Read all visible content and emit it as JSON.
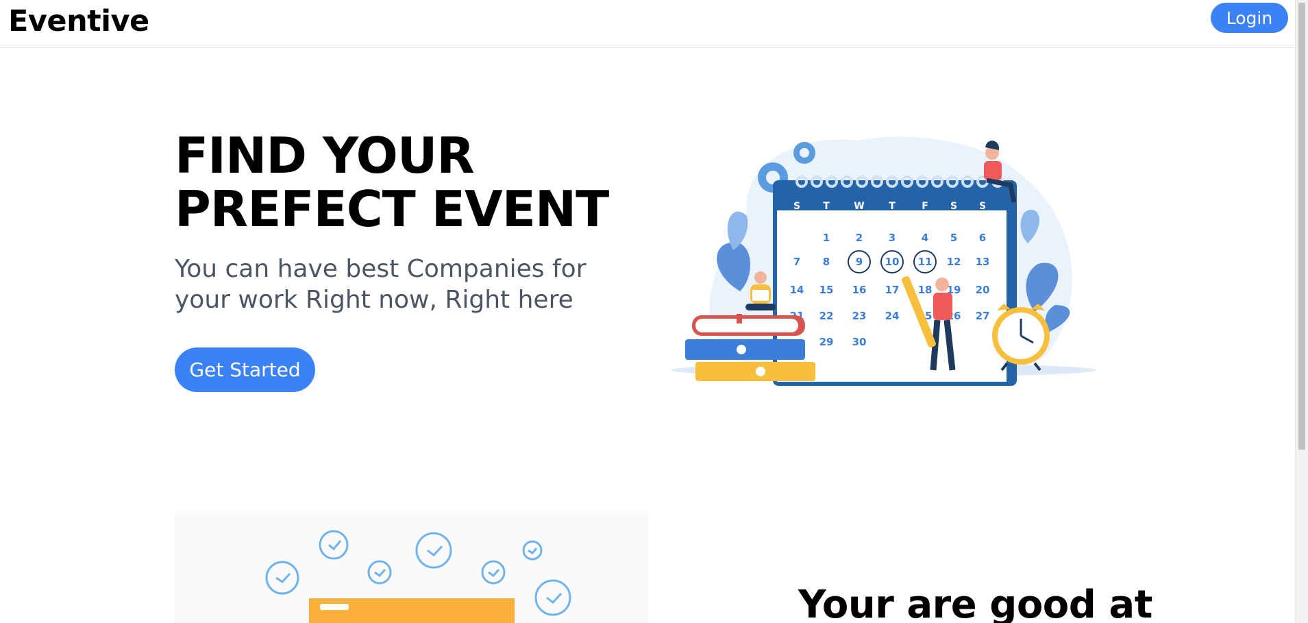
{
  "navbar": {
    "brand": "Eventive",
    "login_label": "Login"
  },
  "hero": {
    "title_line1": "FIND YOUR",
    "title_line2": "PREFECT EVENT",
    "subtitle": "You can have best Companies for your work Right now, Right here",
    "cta_label": "Get Started",
    "calendar": {
      "weekdays": [
        "S",
        "T",
        "W",
        "T",
        "F",
        "S",
        "S"
      ],
      "dates": [
        "1",
        "2",
        "3",
        "4",
        "5",
        "6",
        "7",
        "8",
        "9",
        "10",
        "11",
        "12",
        "13",
        "14",
        "15",
        "16",
        "17",
        "18",
        "19",
        "20",
        "21",
        "22",
        "23",
        "24",
        "25",
        "26",
        "27",
        "29",
        "30"
      ],
      "circled": [
        "9",
        "10",
        "11"
      ]
    }
  },
  "section2": {
    "heading": "Your are good at"
  },
  "colors": {
    "accent": "#3b82f6",
    "calendar_blue": "#2563a8",
    "subtitle_gray": "#4b5563"
  }
}
